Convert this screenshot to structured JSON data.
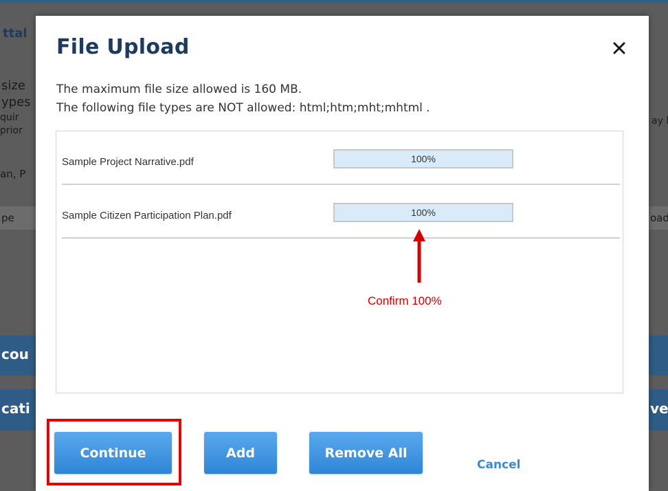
{
  "background": {
    "fragments_left": [
      "ttal",
      "size",
      "ypes",
      "quir",
      "prior",
      "an, P",
      "pe",
      "cou",
      "cati"
    ],
    "fragments_right": [
      "ay l",
      "oad",
      "ve"
    ]
  },
  "dialog": {
    "title": "File Upload",
    "close_glyph": "×",
    "info_line_1": "The maximum file size allowed is 160 MB.",
    "info_line_2": "The following file types are NOT allowed: html;htm;mht;mhtml .",
    "files": [
      {
        "name": "Sample Project Narrative.pdf",
        "progress_percent": 100,
        "progress_label": "100%"
      },
      {
        "name": "Sample Citizen Participation Plan.pdf",
        "progress_percent": 100,
        "progress_label": "100%"
      }
    ],
    "annotation": "Confirm 100%",
    "buttons": {
      "continue": "Continue",
      "add": "Add",
      "remove_all": "Remove All",
      "cancel": "Cancel"
    }
  },
  "colors": {
    "title": "#1f3a5f",
    "button": "#3a8ee0",
    "progress_fill": "#d9ebf9",
    "annotation": "#d40000",
    "highlight": "#e00000"
  }
}
